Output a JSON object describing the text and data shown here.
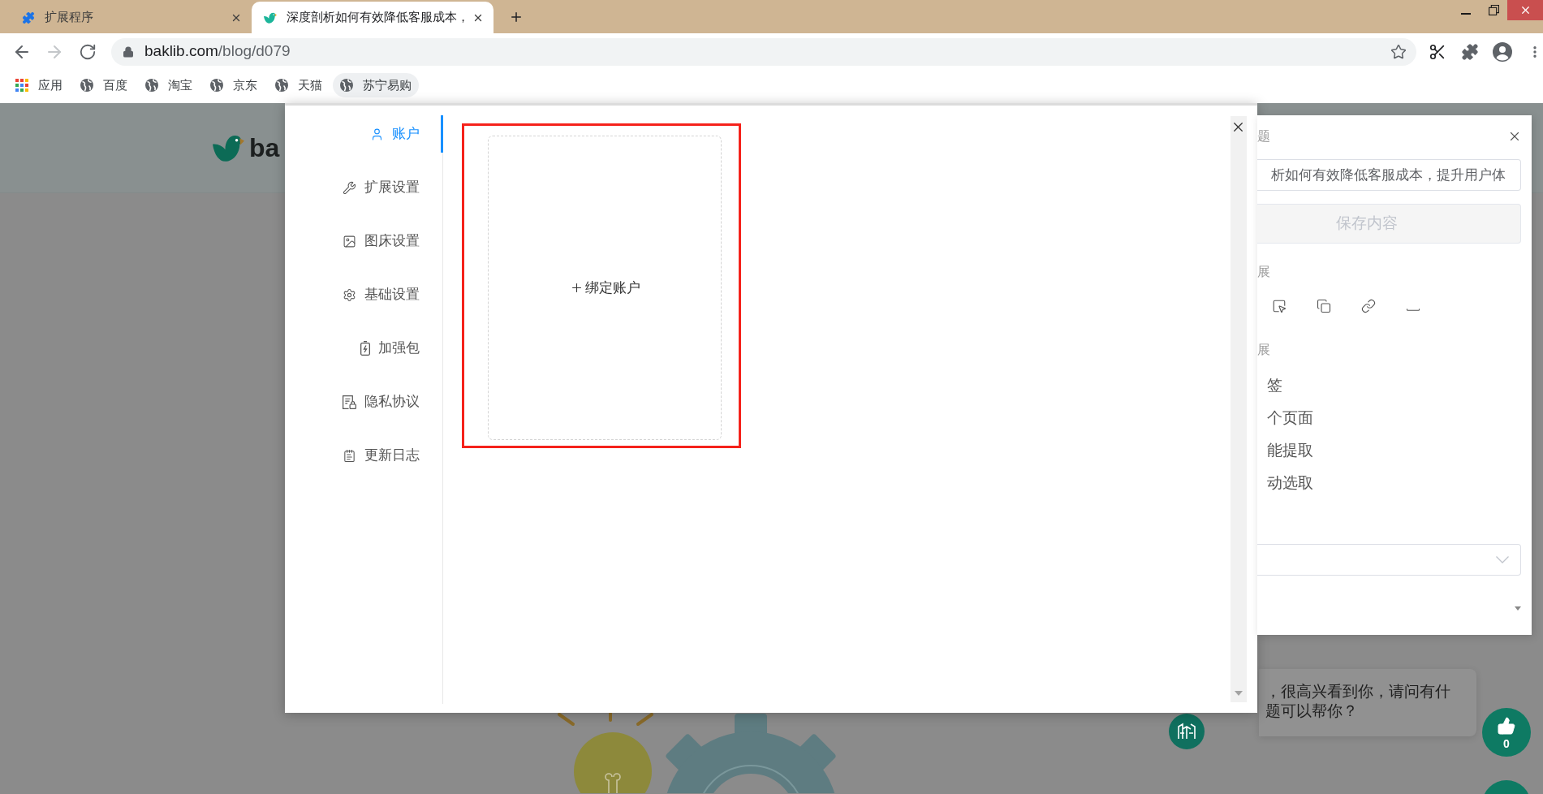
{
  "browser": {
    "tabs": [
      {
        "title": "扩展程序",
        "selected": false
      },
      {
        "title": "深度剖析如何有效降低客服成本，",
        "selected": true
      }
    ],
    "forward_disabled": true,
    "address": {
      "host": "baklib.com",
      "path": "/blog/d079"
    },
    "bookmarks": [
      {
        "kind": "apps",
        "label": "应用",
        "hovered": false
      },
      {
        "kind": "site",
        "label": "百度",
        "hovered": false
      },
      {
        "kind": "site",
        "label": "淘宝",
        "hovered": false
      },
      {
        "kind": "site",
        "label": "京东",
        "hovered": false
      },
      {
        "kind": "site",
        "label": "天猫",
        "hovered": false
      },
      {
        "kind": "site",
        "label": "苏宁易购",
        "hovered": true
      }
    ]
  },
  "page": {
    "logo_text": "ba",
    "chat_message": [
      "，很高兴看到你，请问有什",
      "题可以帮你？"
    ],
    "like_count": "0"
  },
  "settings_modal": {
    "nav": [
      {
        "label": "账户",
        "selected": true
      },
      {
        "label": "扩展设置",
        "selected": false
      },
      {
        "label": "图床设置",
        "selected": false
      },
      {
        "label": "基础设置",
        "selected": false
      },
      {
        "label": "加强包",
        "selected": false
      },
      {
        "label": "隐私协议",
        "selected": false
      },
      {
        "label": "更新日志",
        "selected": false
      }
    ],
    "bind_account": "绑定账户"
  },
  "clipper_panel": {
    "title_label": "题",
    "title_value": "析如何有效降低客服成本，提升用户体",
    "save_button": {
      "label": "保存内容",
      "disabled": true
    },
    "section_1": "展",
    "section_2": "展",
    "modes": [
      "签",
      "个页面",
      "能提取",
      "动选取"
    ]
  }
}
